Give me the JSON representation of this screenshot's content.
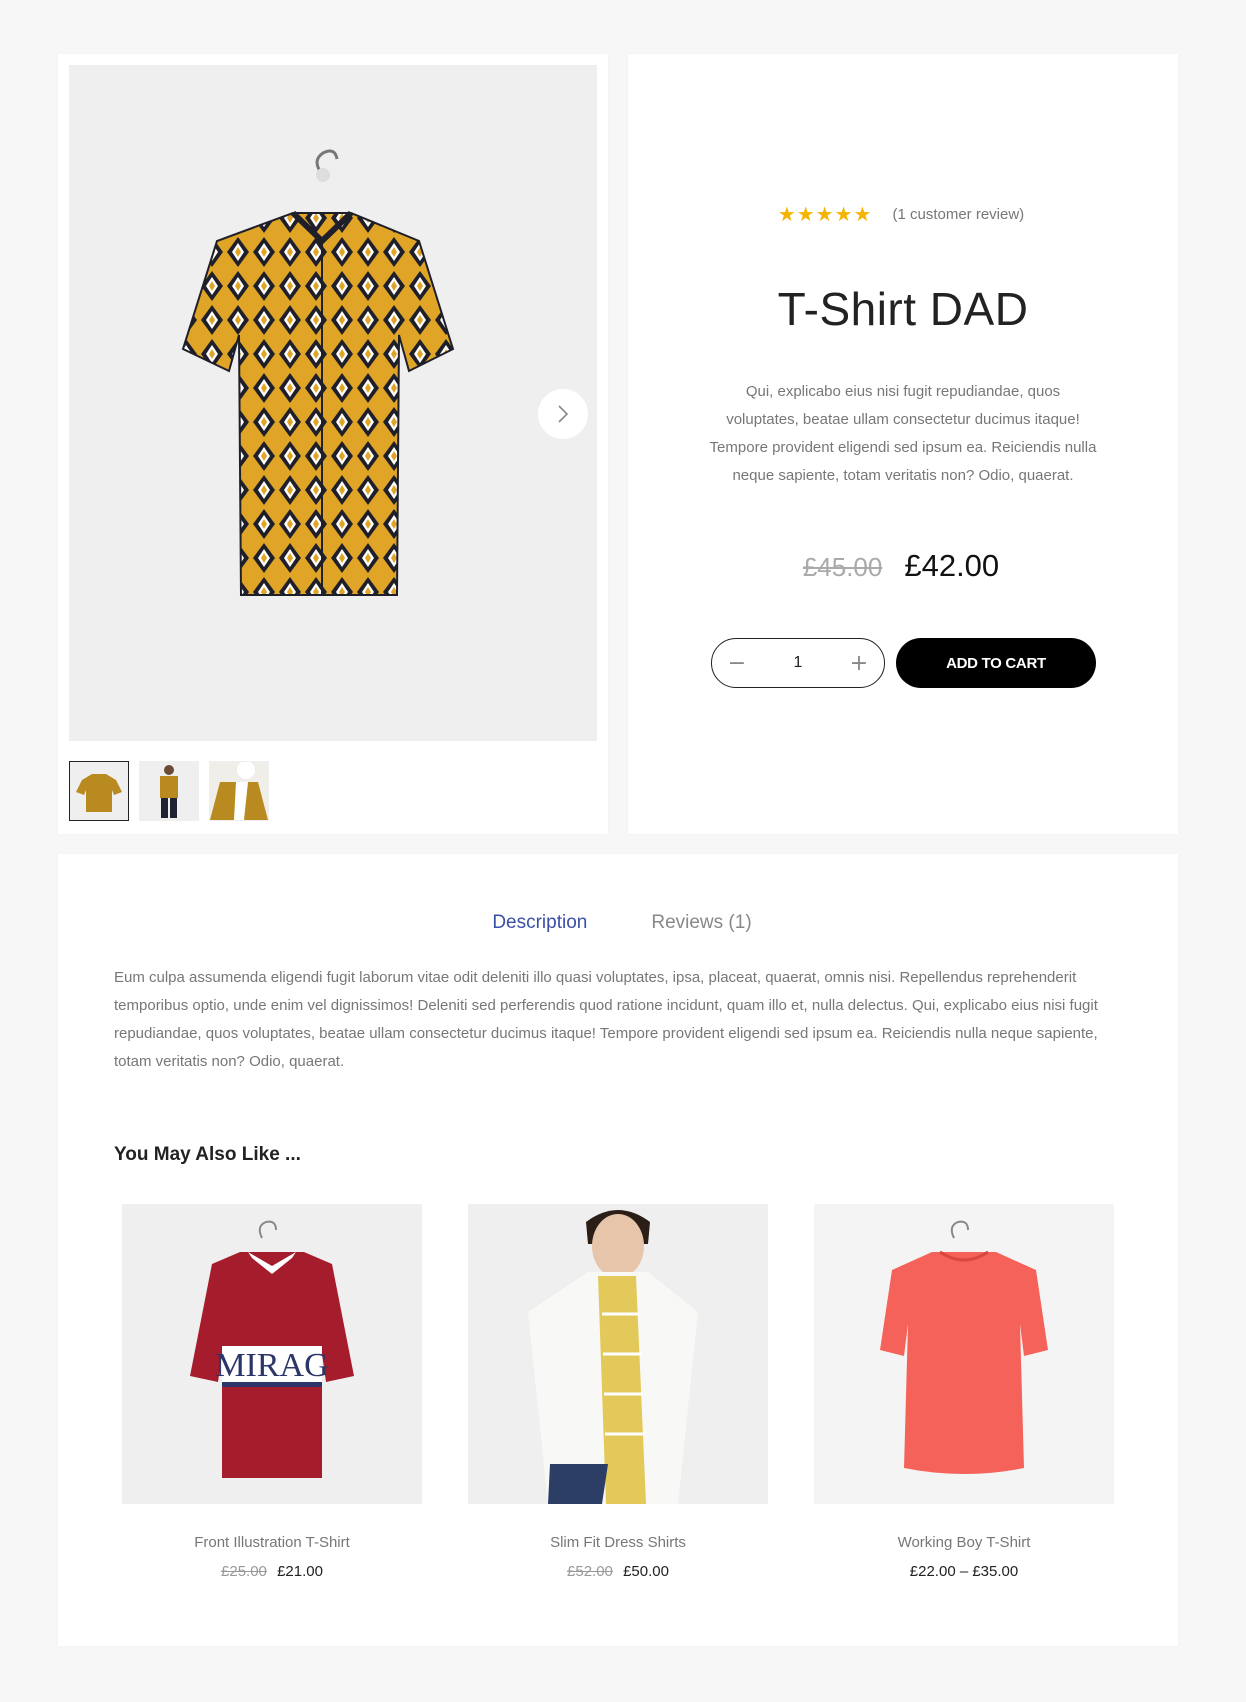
{
  "gallery": {
    "main_image_alt": "T-Shirt DAD",
    "next_icon": "chevron-right-icon",
    "thumbnails": [
      {
        "alt": "thumbnail 1",
        "active": true
      },
      {
        "alt": "thumbnail 2",
        "active": false
      },
      {
        "alt": "thumbnail 3",
        "active": false
      }
    ]
  },
  "summary": {
    "stars": "★★★★★",
    "rating_value": 5,
    "rating_max": 5,
    "review_link": "(1 customer review)",
    "title": "T-Shirt DAD",
    "short_description": "Qui, explicabo eius nisi fugit repudiandae, quos voluptates, beatae ullam consectetur ducimus itaque! Tempore provident eligendi sed ipsum ea. Reiciendis nulla neque sapiente, totam veritatis non? Odio, quaerat.",
    "price_old": "£45.00",
    "price_new": "£42.00",
    "quantity": "1",
    "minus_label": "−",
    "plus_label": "+",
    "add_to_cart": "ADD TO CART"
  },
  "tabs": {
    "items": [
      {
        "label": "Description",
        "active": true
      },
      {
        "label": "Reviews (1)",
        "active": false
      }
    ],
    "description": "Eum culpa assumenda eligendi fugit laborum vitae odit deleniti illo quasi voluptates, ipsa, placeat, quaerat, omnis nisi. Repellendus reprehenderit temporibus optio, unde enim vel dignissimos! Deleniti sed perferendis quod ratione incidunt, quam illo et, nulla delectus. Qui, explicabo eius nisi fugit repudiandae, quos voluptates, beatae ullam consectetur ducimus itaque! Tempore provident eligendi sed ipsum ea. Reiciendis nulla neque sapiente, totam veritatis non? Odio, quaerat."
  },
  "related": {
    "title": "You May Also Like ...",
    "products": [
      {
        "name": "Front Illustration T-Shirt",
        "price_old": "£25.00",
        "price": "£21.00"
      },
      {
        "name": "Slim Fit Dress Shirts",
        "price_old": "£52.00",
        "price": "£50.00"
      },
      {
        "name": "Working Boy T-Shirt",
        "price_old": "",
        "price": "£22.00 – £35.00"
      }
    ]
  },
  "colors": {
    "accent_tab": "#3b4fa8",
    "star": "#f4b400",
    "button_bg": "#000000",
    "shirt_mustard": "#e0a526",
    "shirt_red": "#a51c2c",
    "shirt_coral": "#f4625a"
  }
}
